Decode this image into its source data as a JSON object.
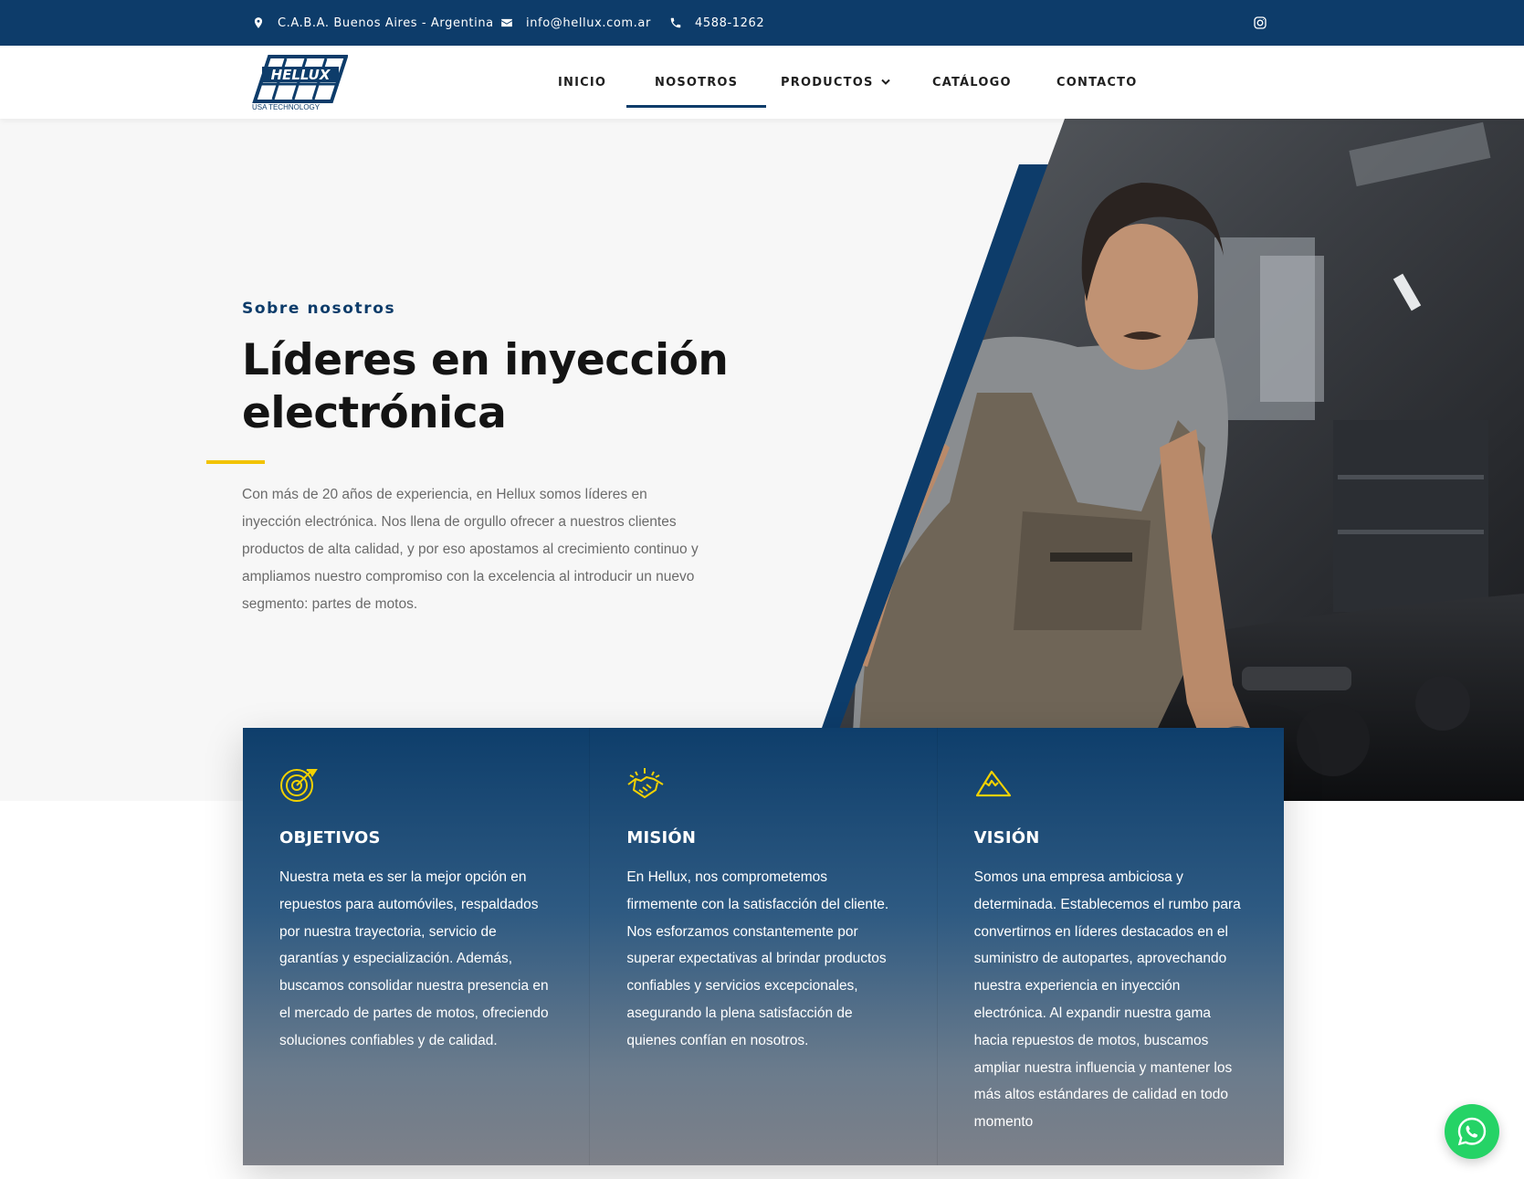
{
  "topbar": {
    "location": "C.A.B.A. Buenos Aires - Argentina",
    "email": "info@hellux.com.ar",
    "phone": "4588-1262",
    "icons": [
      "location-pin-icon",
      "envelope-icon",
      "phone-icon",
      "instagram-icon"
    ]
  },
  "header": {
    "logo_text": "HELLUX",
    "logo_tagline": "USA TECHNOLOGY",
    "nav": [
      {
        "label": "INICIO",
        "active": false
      },
      {
        "label": "NOSOTROS",
        "active": true
      },
      {
        "label": "PRODUCTOS",
        "active": false,
        "has_dropdown": true
      },
      {
        "label": "CATÁLOGO",
        "active": false
      },
      {
        "label": "CONTACTO",
        "active": false
      }
    ]
  },
  "hero": {
    "eyebrow": "Sobre nosotros",
    "title": "Líderes en inyección electrónica",
    "intro": "Con más de 20 años de experiencia, en Hellux somos líderes en inyección electrónica. Nos llena de orgullo ofrecer a nuestros clientes productos de alta calidad, y por eso apostamos al crecimiento continuo y ampliamos nuestro compromiso con la excelencia al introducir un nuevo segmento: partes de motos.",
    "photo": "mechanic-working-on-car-engine"
  },
  "cards": [
    {
      "icon": "target-icon",
      "title": "OBJETIVOS",
      "text": "Nuestra meta es ser la mejor opción en repuestos para automóviles, respaldados por nuestra trayectoria, servicio de garantías y especialización. Además, buscamos consolidar nuestra presencia en el mercado de partes de motos, ofreciendo soluciones confiables y de calidad."
    },
    {
      "icon": "handshake-icon",
      "title": "MISIÓN",
      "text": "En Hellux, nos comprometemos firmemente con la satisfacción del cliente. Nos esforzamos constantemente por superar expectativas al brindar productos confiables y servicios excepcionales, asegurando la plena satisfacción de quienes confían en nosotros."
    },
    {
      "icon": "mountain-icon",
      "title": "VISIÓN",
      "text": "Somos una empresa ambiciosa y determinada. Establecemos el rumbo para convertirnos en líderes destacados en el suministro de autopartes, aprovechando nuestra experiencia en inyección electrónica. Al expandir nuestra gama hacia repuestos de motos, buscamos ampliar nuestra influencia y mantener los más altos estándares de calidad en todo momento"
    }
  ],
  "whatsapp": {
    "icon": "whatsapp-icon"
  },
  "colors": {
    "brand_navy": "#0d3c6a",
    "accent_yellow": "#f2c300",
    "whatsapp_green": "#25d366"
  }
}
